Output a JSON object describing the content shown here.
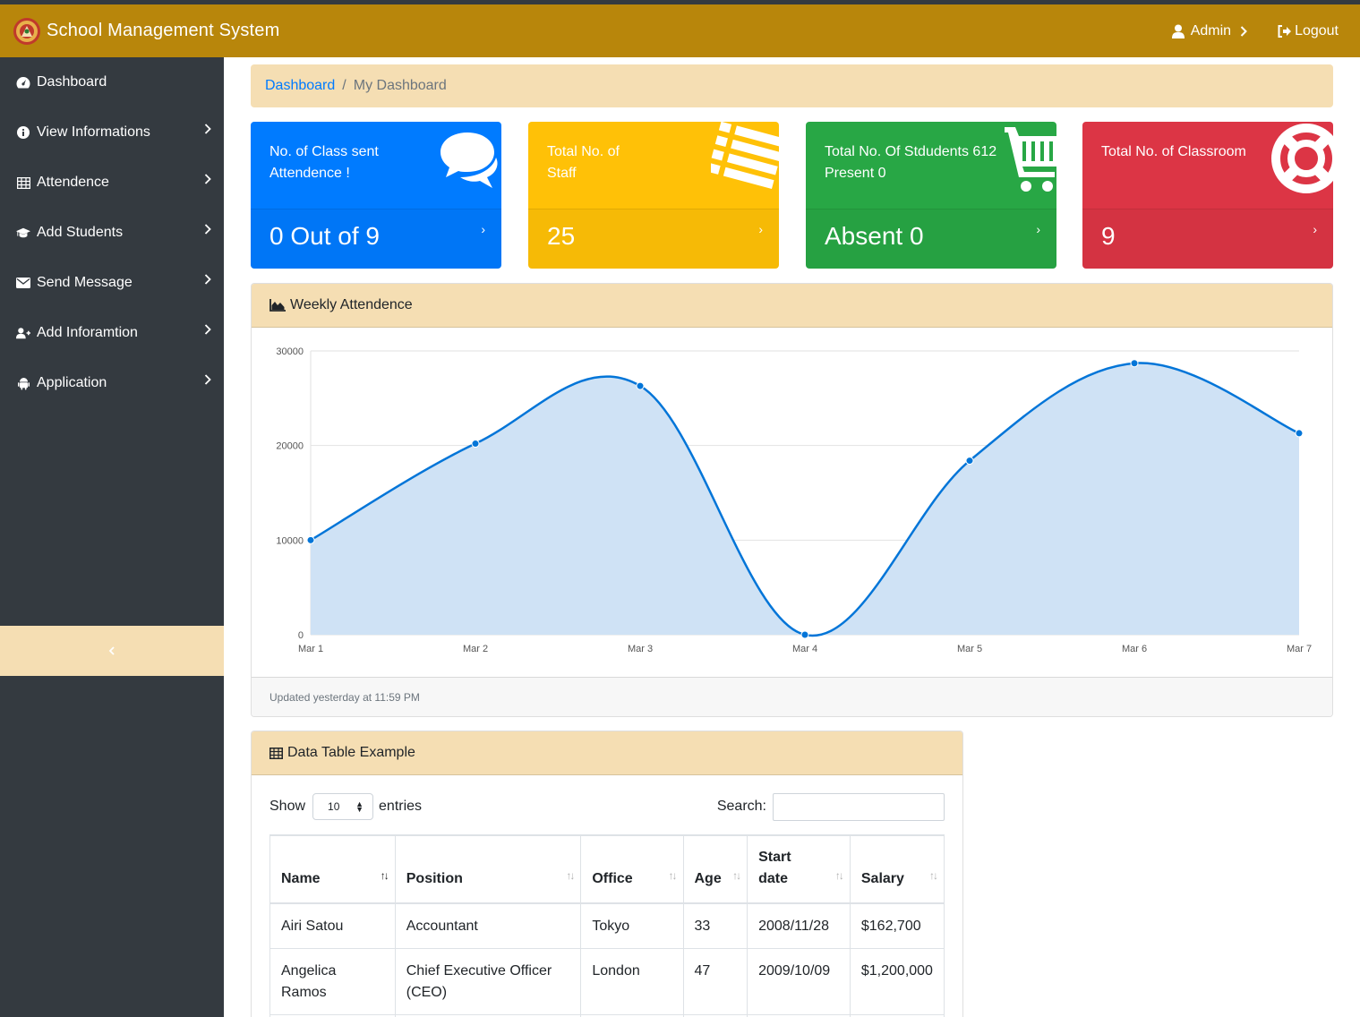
{
  "app": {
    "title": "School Management System",
    "user_label": "Admin",
    "logout_label": "Logout"
  },
  "sidebar": {
    "items": [
      {
        "label": "Dashboard",
        "icon": "dashboard-icon"
      },
      {
        "label": "View Informations",
        "icon": "info-circle-icon"
      },
      {
        "label": "Attendence",
        "icon": "table-icon"
      },
      {
        "label": "Add Students",
        "icon": "graduation-cap-icon"
      },
      {
        "label": "Send Message",
        "icon": "envelope-icon"
      },
      {
        "label": "Add Inforamtion",
        "icon": "user-plus-icon"
      },
      {
        "label": "Application",
        "icon": "android-icon"
      }
    ],
    "collapse_icon": "chevron-left-icon"
  },
  "breadcrumb": {
    "link": "Dashboard",
    "separator": "/",
    "active": "My Dashboard"
  },
  "cards": [
    {
      "text": "No. of Class sent Attendence !",
      "value": "0 Out of 9",
      "color": "#007bff",
      "icon": "comments-icon"
    },
    {
      "text": "Total No. of Staff",
      "value": "25",
      "color": "#ffc107",
      "icon": "list-icon"
    },
    {
      "text": "Total No. Of Stdudents 612 Present 0",
      "value": "Absent 0",
      "color": "#28a745",
      "icon": "shopping-cart-icon"
    },
    {
      "text": "Total No. of Classroom",
      "value": "9",
      "color": "#dc3545",
      "icon": "life-ring-icon"
    }
  ],
  "chart_panel": {
    "title": "Weekly Attendence",
    "footer": "Updated yesterday at 11:59 PM"
  },
  "chart_data": {
    "type": "area",
    "categories": [
      "Mar 1",
      "Mar 2",
      "Mar 3",
      "Mar 4",
      "Mar 5",
      "Mar 6",
      "Mar 7"
    ],
    "series": [
      {
        "values": [
          10000,
          20200,
          26300,
          0,
          18400,
          28700,
          21300
        ]
      }
    ],
    "ylim": [
      0,
      30000
    ],
    "yticks": [
      0,
      10000,
      20000,
      30000
    ],
    "grid": true,
    "line_color": "#0275d8",
    "fill_color": "#cfe2f5"
  },
  "table_panel": {
    "title": "Data Table Example",
    "show_label": "Show",
    "entries_value": "10",
    "entries_label": "entries",
    "search_label": "Search:",
    "columns": [
      "Name",
      "Position",
      "Office",
      "Age",
      "Start date",
      "Salary"
    ],
    "rows": [
      [
        "Airi Satou",
        "Accountant",
        "Tokyo",
        "33",
        "2008/11/28",
        "$162,700"
      ],
      [
        "Angelica Ramos",
        "Chief Executive Officer (CEO)",
        "London",
        "47",
        "2009/10/09",
        "$1,200,000"
      ]
    ]
  }
}
